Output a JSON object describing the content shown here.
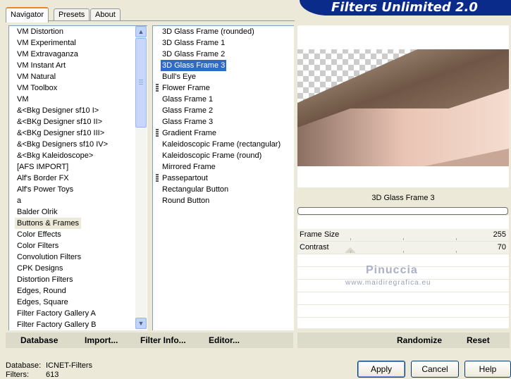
{
  "tabs": [
    {
      "label": "Navigator",
      "active": true
    },
    {
      "label": "Presets",
      "active": false
    },
    {
      "label": "About",
      "active": false
    }
  ],
  "banner_title": "Filters Unlimited 2.0",
  "categories": [
    {
      "label": "VM Distortion"
    },
    {
      "label": "VM Experimental"
    },
    {
      "label": "VM Extravaganza"
    },
    {
      "label": "VM Instant Art"
    },
    {
      "label": "VM Natural"
    },
    {
      "label": "VM Toolbox"
    },
    {
      "label": "VM"
    },
    {
      "label": "&<Bkg Designer sf10 I>"
    },
    {
      "label": "&<BKg Designer sf10 II>"
    },
    {
      "label": "&<BKg Designer sf10 III>"
    },
    {
      "label": "&<Bkg Designers sf10 IV>"
    },
    {
      "label": "&<Bkg Kaleidoscope>"
    },
    {
      "label": "[AFS IMPORT]"
    },
    {
      "label": "Alf's Border FX"
    },
    {
      "label": "Alf's Power Toys"
    },
    {
      "label": "a"
    },
    {
      "label": "Balder Olrik"
    },
    {
      "label": "Buttons & Frames",
      "selected": true
    },
    {
      "label": "Color Effects"
    },
    {
      "label": "Color Filters"
    },
    {
      "label": "Convolution Filters"
    },
    {
      "label": "CPK Designs"
    },
    {
      "label": "Distortion Filters"
    },
    {
      "label": "Edges, Round"
    },
    {
      "label": "Edges, Square"
    },
    {
      "label": "Filter Factory Gallery A"
    },
    {
      "label": "Filter Factory Gallery B"
    }
  ],
  "filters": [
    {
      "label": "3D Glass Frame (rounded)"
    },
    {
      "label": "3D Glass Frame 1"
    },
    {
      "label": "3D Glass Frame 2"
    },
    {
      "label": "3D Glass Frame 3",
      "selected": true
    },
    {
      "label": "Bull's Eye"
    },
    {
      "label": "Flower Frame",
      "submenu": true
    },
    {
      "label": "Glass Frame 1"
    },
    {
      "label": "Glass Frame 2"
    },
    {
      "label": "Glass Frame 3"
    },
    {
      "label": "Gradient Frame",
      "submenu": true
    },
    {
      "label": "Kaleidoscopic Frame (rectangular)"
    },
    {
      "label": "Kaleidoscopic Frame (round)"
    },
    {
      "label": "Mirrored Frame"
    },
    {
      "label": "Passepartout",
      "submenu": true
    },
    {
      "label": "Rectangular Button"
    },
    {
      "label": "Round Button"
    }
  ],
  "preview": {
    "filter_name": "3D Glass Frame 3"
  },
  "params": [
    {
      "label": "Frame Size",
      "value": "255",
      "level": 1.0
    },
    {
      "label": "Contrast",
      "value": "70",
      "level": 0.0
    }
  ],
  "watermark": {
    "name": "Pinuccia",
    "url": "www.maidiregrafica.eu"
  },
  "left_buttons": {
    "database": "Database",
    "import": "Import...",
    "filter_info": "Filter Info...",
    "editor": "Editor..."
  },
  "right_buttons": {
    "randomize": "Randomize",
    "reset": "Reset"
  },
  "status": {
    "database_label": "Database:",
    "database_value": "ICNET-Filters",
    "filters_label": "Filters:",
    "filters_value": "613"
  },
  "dialog_buttons": {
    "apply": "Apply",
    "cancel": "Cancel",
    "help": "Help"
  },
  "colors": {
    "selection": "#316ac5",
    "banner": "#0a2b8a"
  }
}
